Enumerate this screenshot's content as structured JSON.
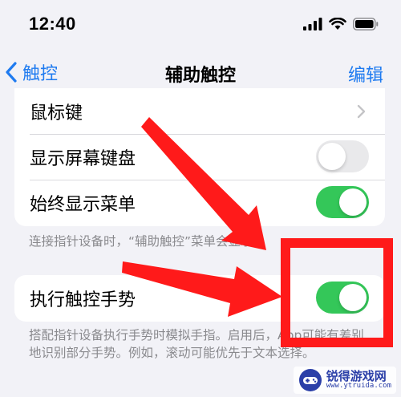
{
  "status_bar": {
    "time": "12:40"
  },
  "nav": {
    "back_label": "触控",
    "title": "辅助触控",
    "edit_label": "编辑"
  },
  "settings_group_1": {
    "rows": [
      {
        "label": "鼠标键",
        "control": "chevron"
      },
      {
        "label": "显示屏幕键盘",
        "control": "toggle",
        "state": "off"
      },
      {
        "label": "始终显示菜单",
        "control": "toggle",
        "state": "on"
      }
    ],
    "footnote": "连接指针设备时，“辅助触控”菜单会显示。"
  },
  "settings_group_2": {
    "rows": [
      {
        "label": "执行触控手势",
        "control": "toggle",
        "state": "on"
      }
    ],
    "footnote": "搭配指针设备执行手势时模拟手指。启用后，App可能有差别地识别部分手势。例如，滚动可能优先于文本选择。"
  },
  "watermark": {
    "name": "锐得游戏网",
    "url": "www.ytruida.com"
  },
  "colors": {
    "accent": "#1f7bf0",
    "toggle_on": "#34c759",
    "annotation": "#ff1a1a"
  },
  "icons": [
    "cellular-signal-icon",
    "wifi-icon",
    "battery-icon",
    "back-chevron-icon",
    "chevron-right-icon"
  ]
}
